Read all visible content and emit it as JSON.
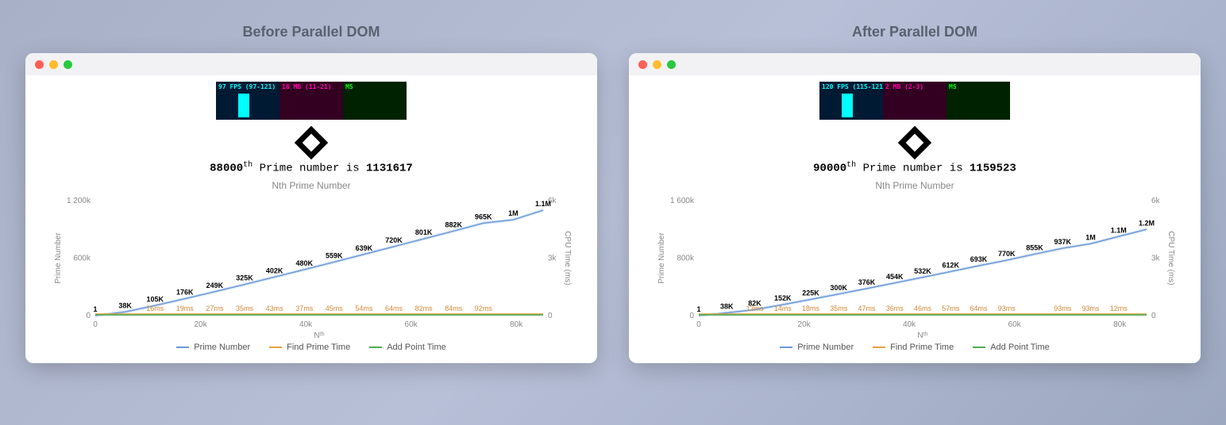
{
  "chart_data": [
    {
      "type": "line",
      "title": "Nth Prime Number",
      "xlabel": "Nᵗʰ",
      "ylabel": "Prime Number",
      "ylabel2": "CPU Time (ms)",
      "xlim": [
        0,
        90000
      ],
      "ylim": [
        0,
        1200000
      ],
      "ylim2": [
        0,
        6000
      ],
      "xticks": [
        0,
        20000,
        40000,
        60000,
        80000
      ],
      "yticks": [
        0,
        600000,
        1200000
      ],
      "yticks2": [
        0,
        3000,
        6000
      ],
      "series": [
        {
          "name": "Prime Number",
          "x_step": 5000,
          "values": [
            1,
            38000,
            105000,
            176000,
            249000,
            325000,
            402000,
            480000,
            559000,
            639000,
            720000,
            801000,
            882000,
            965000,
            1000000,
            1100000
          ]
        },
        {
          "name": "Find Prime Time",
          "x_step": 5000,
          "values_ms": [
            null,
            null,
            16,
            19,
            27,
            35,
            43,
            37,
            45,
            54,
            64,
            82,
            84,
            92,
            null,
            null
          ]
        },
        {
          "name": "Add Point Time"
        }
      ]
    },
    {
      "type": "line",
      "title": "Nth Prime Number",
      "xlabel": "Nᵗʰ",
      "ylabel": "Prime Number",
      "ylabel2": "CPU Time (ms)",
      "xlim": [
        0,
        95000
      ],
      "ylim": [
        0,
        1600000
      ],
      "ylim2": [
        0,
        6000
      ],
      "xticks": [
        0,
        20000,
        40000,
        60000,
        80000
      ],
      "yticks": [
        0,
        800000,
        1600000
      ],
      "yticks2": [
        0,
        3000,
        6000
      ],
      "series": [
        {
          "name": "Prime Number",
          "x_step": 5000,
          "values": [
            1,
            38000,
            82000,
            152000,
            225000,
            300000,
            376000,
            454000,
            532000,
            612000,
            693000,
            770000,
            855000,
            937000,
            1000000,
            1100000,
            1200000
          ]
        },
        {
          "name": "Find Prime Time",
          "x_step": 5000,
          "values_ms": [
            null,
            null,
            13,
            14,
            18,
            35,
            47,
            36,
            46,
            57,
            64,
            93,
            null,
            93,
            93,
            12,
            null
          ]
        },
        {
          "name": "Add Point Time"
        }
      ]
    }
  ],
  "panels": [
    {
      "title": "Before Parallel DOM",
      "stats": {
        "fps": "97 FPS (97-121)",
        "mb": "18 MB (11-21)",
        "ms": "MS"
      },
      "prime_n": "88000",
      "prime_suffix": "th",
      "prime_mid": " Prime number is ",
      "prime_value": "1131617",
      "chart_title": "Nth Prime Number",
      "ylabel": "Prime Number",
      "ylabel2": "CPU Time (ms)",
      "xlabel": "Nᵗʰ",
      "xticks": [
        "0",
        "20k",
        "40k",
        "60k",
        "80k"
      ],
      "yticks": [
        "0",
        "600k",
        "1 200k"
      ],
      "yticks2": [
        "0",
        "3k",
        "6k"
      ],
      "legend": [
        "Prime Number",
        "Find Prime Time",
        "Add Point Time"
      ],
      "data_labels": [
        "1",
        "38K",
        "105K",
        "176K",
        "249K",
        "325K",
        "402K",
        "480K",
        "559K",
        "639K",
        "720K",
        "801K",
        "882K",
        "965K",
        "1M",
        "1.1M"
      ],
      "time_labels": [
        "",
        "",
        "16ms",
        "19ms",
        "27ms",
        "35ms",
        "43ms",
        "37ms",
        "45ms",
        "54ms",
        "64ms",
        "82ms",
        "84ms",
        "92ms",
        "",
        ""
      ],
      "n_points": 16,
      "ymax": 1200000,
      "values": [
        1,
        38000,
        105000,
        176000,
        249000,
        325000,
        402000,
        480000,
        559000,
        639000,
        720000,
        801000,
        882000,
        965000,
        1000000,
        1100000
      ]
    },
    {
      "title": "After Parallel DOM",
      "stats": {
        "fps": "120 FPS (115-121)",
        "mb": "2 MB (2-3)",
        "ms": "MS"
      },
      "prime_n": "90000",
      "prime_suffix": "th",
      "prime_mid": " Prime number is ",
      "prime_value": "1159523",
      "chart_title": "Nth Prime Number",
      "ylabel": "Prime Number",
      "ylabel2": "CPU Time (ms)",
      "xlabel": "Nᵗʰ",
      "xticks": [
        "0",
        "20k",
        "40k",
        "60k",
        "80k"
      ],
      "yticks": [
        "0",
        "800k",
        "1 600k"
      ],
      "yticks2": [
        "0",
        "3k",
        "6k"
      ],
      "legend": [
        "Prime Number",
        "Find Prime Time",
        "Add Point Time"
      ],
      "data_labels": [
        "1",
        "38K",
        "82K",
        "152K",
        "225K",
        "300K",
        "376K",
        "454K",
        "532K",
        "612K",
        "693K",
        "770K",
        "855K",
        "937K",
        "1M",
        "1.1M",
        "1.2M"
      ],
      "time_labels": [
        "",
        "",
        "13ms",
        "14ms",
        "18ms",
        "35ms",
        "47ms",
        "36ms",
        "46ms",
        "57ms",
        "64ms",
        "93ms",
        "",
        "93ms",
        "93ms",
        "12ms",
        ""
      ],
      "n_points": 17,
      "ymax": 1600000,
      "values": [
        1,
        38000,
        82000,
        152000,
        225000,
        300000,
        376000,
        454000,
        532000,
        612000,
        693000,
        770000,
        855000,
        937000,
        1000000,
        1100000,
        1200000
      ]
    }
  ]
}
